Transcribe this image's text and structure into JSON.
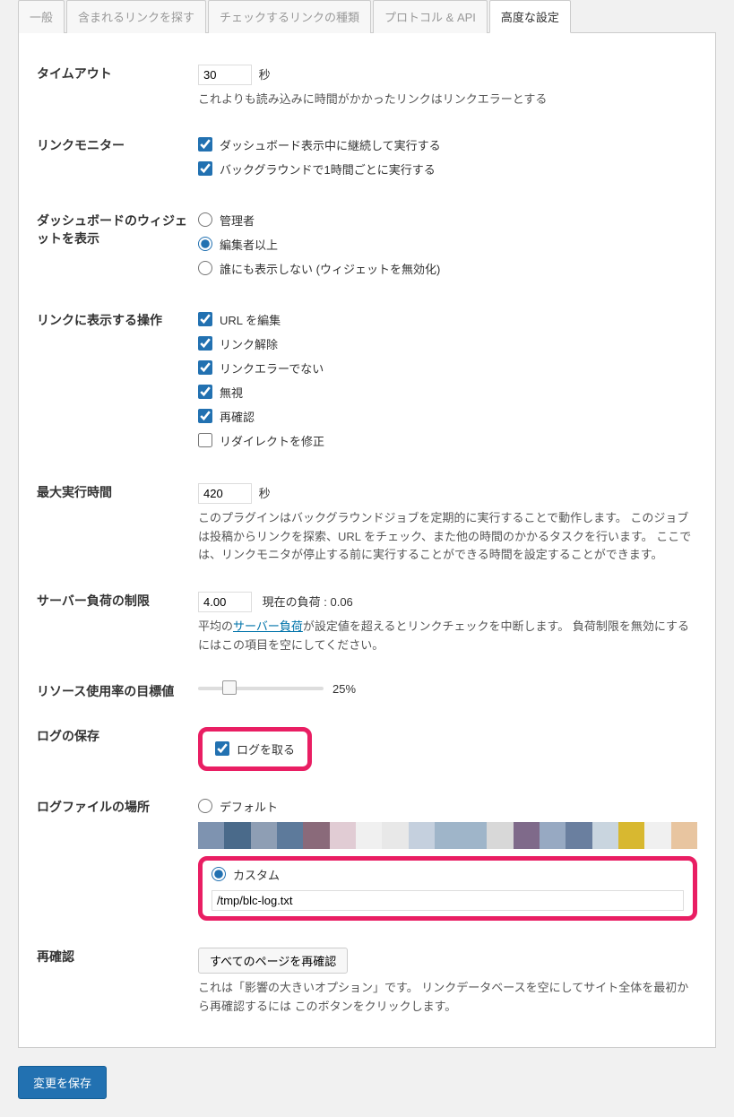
{
  "tabs": {
    "general": "一般",
    "find_links": "含まれるリンクを探す",
    "link_types": "チェックするリンクの種類",
    "protocol": "プロトコル & API",
    "advanced": "高度な設定"
  },
  "timeout": {
    "label": "タイムアウト",
    "value": "30",
    "unit": "秒",
    "desc": "これよりも読み込みに時間がかかったリンクはリンクエラーとする"
  },
  "link_monitor": {
    "label": "リンクモニター",
    "opt1": "ダッシュボード表示中に継続して実行する",
    "opt2": "バックグラウンドで1時間ごとに実行する"
  },
  "dashboard_widget": {
    "label": "ダッシュボードのウィジェットを表示",
    "opt1": "管理者",
    "opt2": "編集者以上",
    "opt3": "誰にも表示しない (ウィジェットを無効化)"
  },
  "link_actions": {
    "label": "リンクに表示する操作",
    "opt1": "URL を編集",
    "opt2": "リンク解除",
    "opt3": "リンクエラーでない",
    "opt4": "無視",
    "opt5": "再確認",
    "opt6": "リダイレクトを修正"
  },
  "max_exec": {
    "label": "最大実行時間",
    "value": "420",
    "unit": "秒",
    "desc": "このプラグインはバックグラウンドジョブを定期的に実行することで動作します。 このジョブは投稿からリンクを探索、URL をチェック、また他の時間のかかるタスクを行います。 ここでは、リンクモニタが停止する前に実行することができる時間を設定することができます。"
  },
  "server_load": {
    "label": "サーバー負荷の制限",
    "value": "4.00",
    "current_label": "現在の負荷 :",
    "current_value": "0.06",
    "desc_pre": "平均の",
    "link_text": "サーバー負荷",
    "desc_post": "が設定値を超えるとリンクチェックを中断します。 負荷制限を無効にするにはこの項目を空にしてください。"
  },
  "resource": {
    "label": "リソース使用率の目標値",
    "value": "25%"
  },
  "log_save": {
    "label": "ログの保存",
    "opt": "ログを取る"
  },
  "log_location": {
    "label": "ログファイルの場所",
    "opt1": "デフォルト",
    "opt2": "カスタム",
    "path": "/tmp/blc-log.txt"
  },
  "recheck": {
    "label": "再確認",
    "button": "すべてのページを再確認",
    "desc": "これは「影響の大きいオプション」です。 リンクデータベースを空にしてサイト全体を最初から再確認するには このボタンをクリックします。"
  },
  "save_button": "変更を保存",
  "pixelated_colors": [
    "#7e93b0",
    "#4a6a8a",
    "#8e9eb4",
    "#5d7a9b",
    "#8a6a7a",
    "#e1ccd4",
    "#f0f0f0",
    "#e8e8e8",
    "#c5d0de",
    "#9fb5c9",
    "#9fb5c9",
    "#d8d8d8",
    "#7f6a8a",
    "#97a9c2",
    "#6a7f9f",
    "#c9d5df",
    "#d8b830",
    "#f0f0f0",
    "#e8c5a0"
  ]
}
